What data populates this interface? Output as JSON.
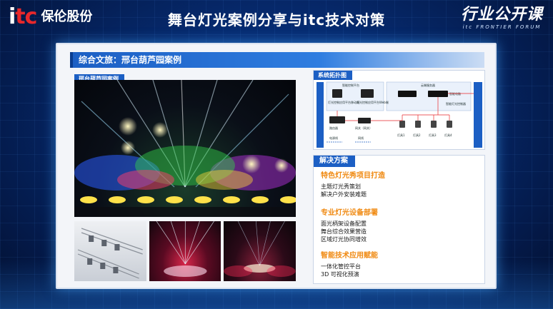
{
  "header": {
    "logo_mark": "itc",
    "logo_name": "保伦股份",
    "title": "舞台灯光案例分享与itc技术对策",
    "forum_cn": "行业公开课",
    "forum_en": "itc FRONTIER FORUM"
  },
  "slide": {
    "title": "综合文旅：邢台葫芦园案例",
    "photo_label": "邢台葫芦园案例",
    "topology": {
      "label": "系统拓扑图",
      "nodes": {
        "smart_control": "智能控制平台",
        "tablet_app": "灯光控制应用平台移动端",
        "web_app": "灯光控制应用平台Web端",
        "cloud": "云端服务器",
        "server": "智能电脑",
        "lighting_controller": "智能灯光控制器",
        "router": "路由器",
        "gateway": "网关（网关）",
        "power": "电源线",
        "net": "网线",
        "left_side": "智能监控中心",
        "right_side": "集中控制设备",
        "lamps": [
          "灯具1",
          "灯具2",
          "灯具3",
          "灯具4"
        ]
      }
    },
    "solutions": {
      "title": "解决方案",
      "groups": [
        {
          "head": "特色灯光秀项目打造",
          "items": [
            "主题灯光秀策划",
            "解决户外安装难题"
          ]
        },
        {
          "head": "专业灯光设备部署",
          "items": [
            "面光柄架设备配置",
            "舞台综合效果营造",
            "区域灯光协同增效"
          ]
        },
        {
          "head": "智能技术应用赋能",
          "items": [
            "一体化管控平台",
            "3D 可视化预演"
          ]
        }
      ]
    }
  },
  "colors": {
    "accent_blue": "#1c5fc4",
    "accent_orange": "#f08a12",
    "brand_red": "#e8282b"
  }
}
